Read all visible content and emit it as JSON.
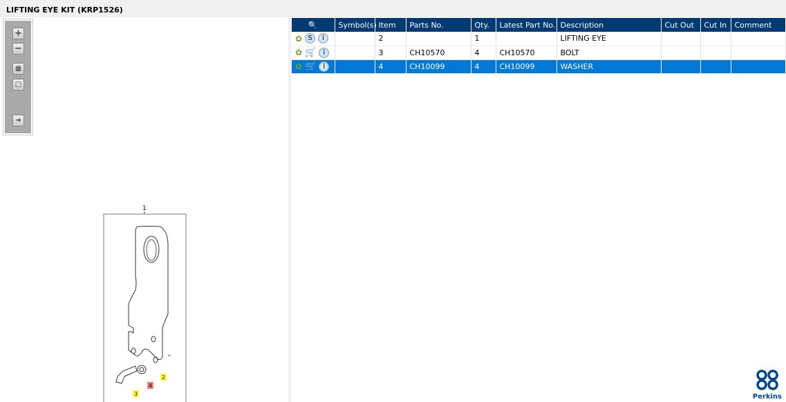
{
  "window": {
    "title": "LIFTING EYE KIT (KRP1526)"
  },
  "toolbar": {
    "zoom_in": "zoom-in",
    "zoom_out": "zoom-out",
    "fit": "fit",
    "reset": "reset",
    "export": "export"
  },
  "drawing": {
    "callouts": [
      "1",
      "2",
      "3",
      "4"
    ]
  },
  "table": {
    "headers": [
      "",
      "Symbol(s)",
      "Item",
      "Parts No.",
      "Qty.",
      "Latest Part No.",
      "Description",
      "Cut Out",
      "Cut In",
      "Comment"
    ],
    "rows": [
      {
        "icon2": "S",
        "item": "2",
        "parts_no": "",
        "qty": "1",
        "latest": "",
        "description": "LIFTING EYE",
        "cut_out": "",
        "cut_in": "",
        "comment": ""
      },
      {
        "icon2": "cart",
        "item": "3",
        "parts_no": "CH10570",
        "qty": "4",
        "latest": "CH10570",
        "description": "BOLT",
        "cut_out": "",
        "cut_in": "",
        "comment": ""
      },
      {
        "icon2": "cart",
        "item": "4",
        "parts_no": "CH10099",
        "qty": "4",
        "latest": "CH10099",
        "description": "WASHER",
        "cut_out": "",
        "cut_in": "",
        "comment": "",
        "selected": true
      }
    ]
  },
  "logo": {
    "text": "Perkins"
  },
  "colors": {
    "header": "#003a73",
    "selected": "#0078d7"
  }
}
